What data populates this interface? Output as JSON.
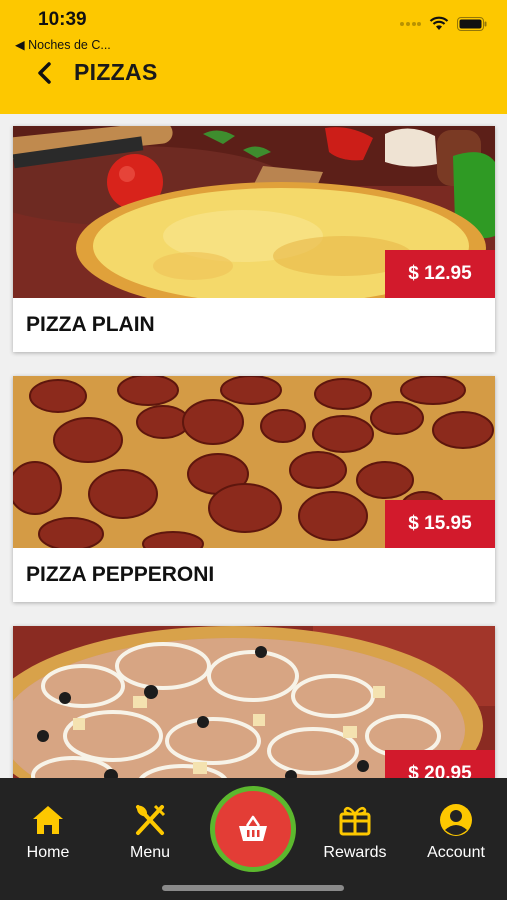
{
  "status": {
    "time": "10:39",
    "back_app": "◀ Noches de C..."
  },
  "header": {
    "title": "PIZZAS"
  },
  "items": [
    {
      "name": "PIZZA PLAIN",
      "price": "$ 12.95"
    },
    {
      "name": "PIZZA PEPPERONI",
      "price": "$ 15.95"
    },
    {
      "name": "",
      "price": "$ 20.95"
    }
  ],
  "tabs": {
    "home": "Home",
    "menu": "Menu",
    "rewards": "Rewards",
    "account": "Account"
  },
  "colors": {
    "brand_yellow": "#fdc800",
    "price_red": "#d21a2c",
    "cart_red": "#e33d36",
    "cart_ring": "#5cb82e",
    "tabbar": "#232323"
  }
}
